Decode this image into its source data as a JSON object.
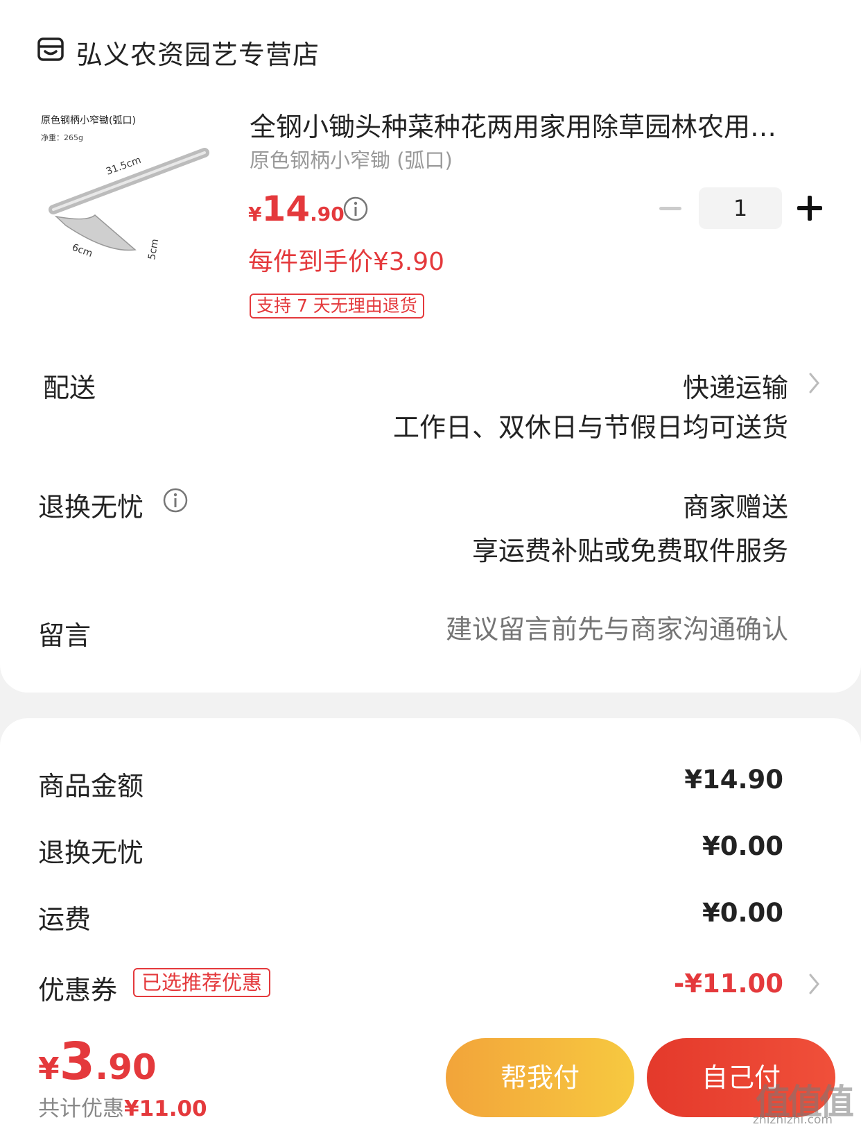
{
  "store": {
    "name": "弘义农资园艺专营店",
    "icon": "store-icon"
  },
  "product": {
    "image_caption": "原色钢柄小窄锄(弧口)",
    "image_weight": "净重：265g",
    "image_dim_long": "31.5cm",
    "image_dim_width": "6cm",
    "image_dim_height": "5cm",
    "title": "全钢小锄头种菜种花两用家用除草园林农用…",
    "spec": "原色钢柄小窄锄 (弧口)",
    "price_currency": "¥",
    "price_int": "14",
    "price_dec": ".90",
    "final_price": "每件到手价¥3.90",
    "return_tag": "支持 7 天无理由退货",
    "quantity": "1"
  },
  "delivery": {
    "label": "配送",
    "method": "快递运输",
    "note": "工作日、双休日与节假日均可送货"
  },
  "return_service": {
    "label": "退换无忧",
    "value": "商家赠送",
    "note": "享运费补贴或免费取件服务"
  },
  "message": {
    "label": "留言",
    "placeholder": "建议留言前先与商家沟通确认"
  },
  "summary": {
    "subtotal_label": "商品金额",
    "subtotal_value": "¥14.90",
    "insurance_label": "退换无忧",
    "insurance_value": "¥0.00",
    "shipping_label": "运费",
    "shipping_value": "¥0.00",
    "coupon_label": "优惠券",
    "coupon_tag": "已选推荐优惠",
    "coupon_value": "-¥11.00"
  },
  "footer": {
    "total_currency": "¥",
    "total_int": "3",
    "total_dec": ".90",
    "discount_prefix": "共计优惠",
    "discount_amount": "¥11.00",
    "help_pay": "帮我付",
    "self_pay": "自己付"
  },
  "watermark": {
    "text": "值值值",
    "url": "zhizhizhi.com"
  },
  "colors": {
    "accent": "#e4393c",
    "help_btn": "#f5b83c",
    "self_btn": "#e84332"
  }
}
